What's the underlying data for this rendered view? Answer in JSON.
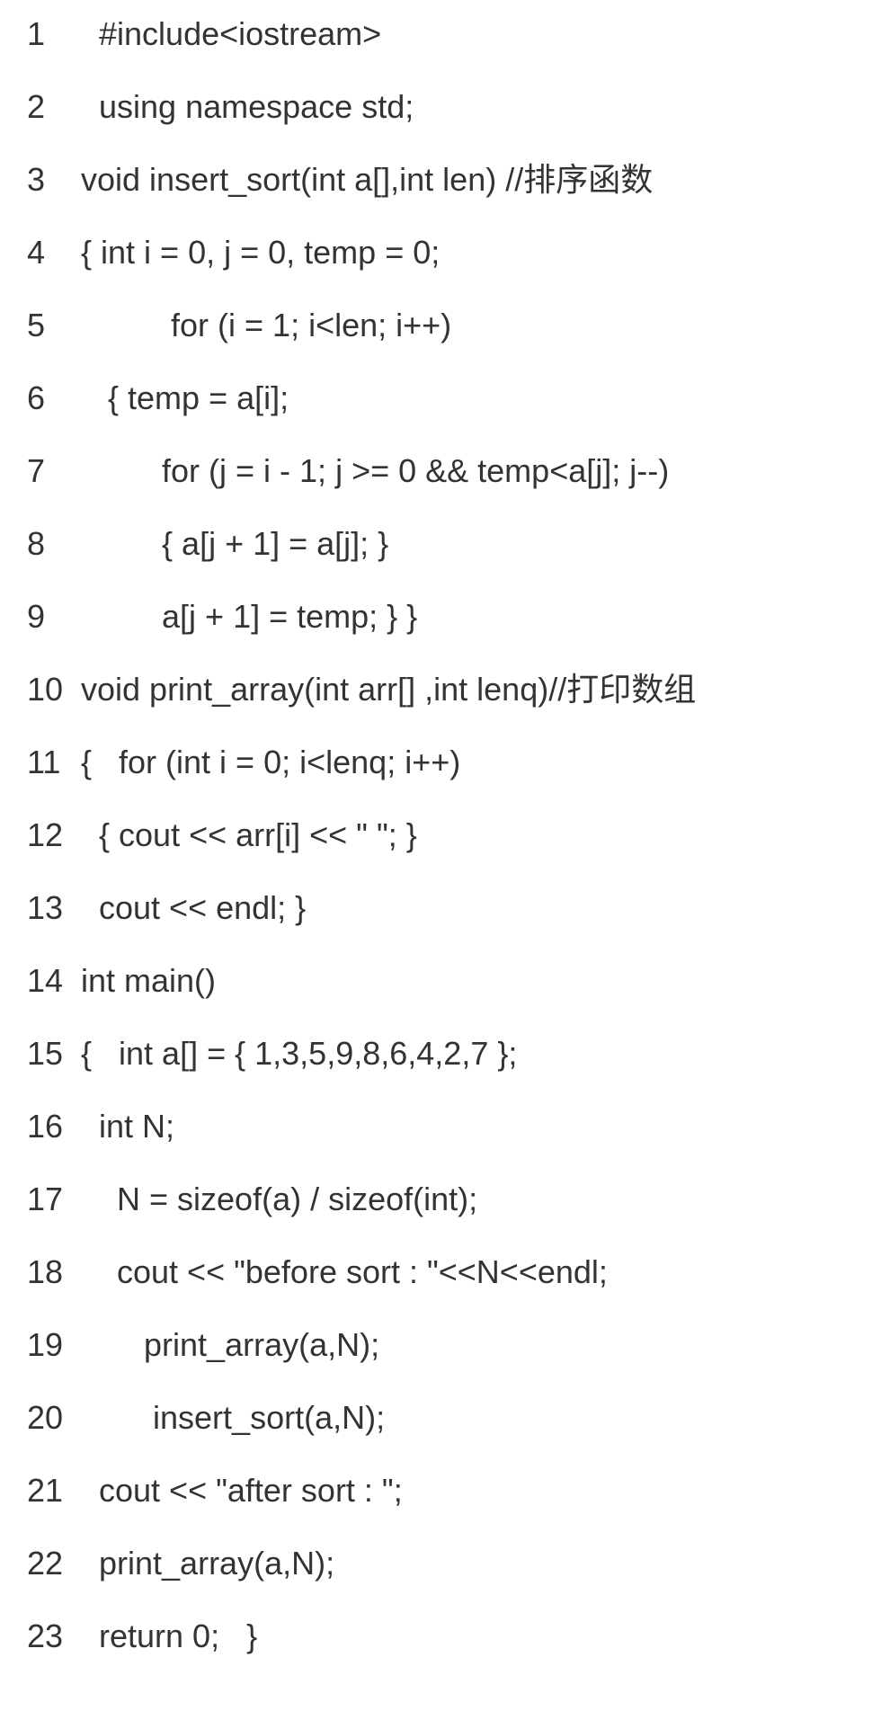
{
  "lines": [
    {
      "n": "1",
      "text": "   #include<iostream>"
    },
    {
      "n": "2",
      "text": "   using namespace std;"
    },
    {
      "n": "3",
      "text": " void insert_sort(int a[],int len) //排序函数"
    },
    {
      "n": "4",
      "text": " { int i = 0, j = 0, temp = 0;"
    },
    {
      "n": "5",
      "text": "           for (i = 1; i<len; i++)"
    },
    {
      "n": "6",
      "text": "    { temp = a[i];"
    },
    {
      "n": "7",
      "text": "          for (j = i - 1; j >= 0 && temp<a[j]; j--)"
    },
    {
      "n": "8",
      "text": "          { a[j + 1] = a[j]; }"
    },
    {
      "n": "9",
      "text": "          a[j + 1] = temp; } }"
    },
    {
      "n": "10",
      "text": " void print_array(int arr[] ,int lenq)//打印数组"
    },
    {
      "n": "11",
      "text": " {   for (int i = 0; i<lenq; i++)"
    },
    {
      "n": "12",
      "text": "   { cout << arr[i] << \" \"; }"
    },
    {
      "n": "13",
      "text": "   cout << endl; }"
    },
    {
      "n": "14",
      "text": " int main()"
    },
    {
      "n": "15",
      "text": " {   int a[] = { 1,3,5,9,8,6,4,2,7 };"
    },
    {
      "n": "16",
      "text": "   int N;"
    },
    {
      "n": "17",
      "text": "     N = sizeof(a) / sizeof(int);"
    },
    {
      "n": "18",
      "text": "     cout << \"before sort : \"<<N<<endl;"
    },
    {
      "n": "19",
      "text": "        print_array(a,N);"
    },
    {
      "n": "20",
      "text": "         insert_sort(a,N);"
    },
    {
      "n": "21",
      "text": "   cout << \"after sort : \";"
    },
    {
      "n": "22",
      "text": "   print_array(a,N);"
    },
    {
      "n": "23",
      "text": "   return 0;   }"
    }
  ]
}
